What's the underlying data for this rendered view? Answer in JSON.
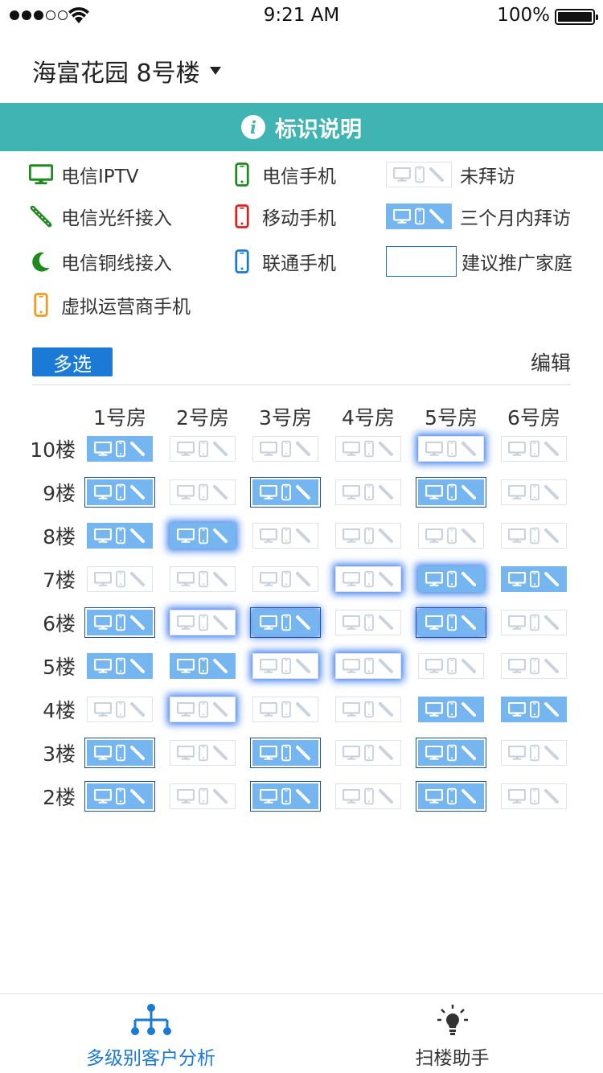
{
  "status_bar": {
    "time": "9:21 AM",
    "battery": "100%"
  },
  "header": {
    "building": "海富花园 8号楼"
  },
  "legend": {
    "title": "标识说明",
    "items": [
      {
        "icon": "tv-icon",
        "color": "#1e8a1e",
        "label": "电信IPTV"
      },
      {
        "icon": "phone-icon",
        "color": "#1e8a1e",
        "label": "电信手机"
      },
      {
        "icon": "not-visited-sample",
        "label": "未拜访"
      },
      {
        "icon": "fiber-icon",
        "color": "#1e8a1e",
        "label": "电信光纤接入"
      },
      {
        "icon": "phone-icon",
        "color": "#e02020",
        "label": "移动手机"
      },
      {
        "icon": "visited-sample",
        "label": "三个月内拜访"
      },
      {
        "icon": "copper-icon",
        "color": "#1e8a1e",
        "label": "电信铜线接入"
      },
      {
        "icon": "phone-icon",
        "color": "#1a7ad6",
        "label": "联通手机"
      },
      {
        "icon": "suggest-sample",
        "label": "建议推广家庭"
      },
      {
        "icon": "phone-icon",
        "color": "#f29a1f",
        "label": "虚拟运营商手机"
      }
    ]
  },
  "toolbar": {
    "multi_select": "多选",
    "edit": "编辑"
  },
  "colors": {
    "accent": "#1a7ad6",
    "banner": "#40b4b2",
    "visited": "#76b6f0",
    "glow": "#3f7fec"
  },
  "grid": {
    "rooms": [
      "1号房",
      "2号房",
      "3号房",
      "4号房",
      "5号房",
      "6号房"
    ],
    "floors": [
      {
        "label": "10楼",
        "cells": [
          "V",
          "U",
          "U",
          "U",
          "UG",
          "U"
        ]
      },
      {
        "label": "9楼",
        "cells": [
          "VS",
          "U",
          "VS",
          "U",
          "VS",
          "U"
        ]
      },
      {
        "label": "8楼",
        "cells": [
          "V",
          "VG",
          "U",
          "U",
          "U",
          "U"
        ]
      },
      {
        "label": "7楼",
        "cells": [
          "U",
          "U",
          "U",
          "UG",
          "VG",
          "V"
        ]
      },
      {
        "label": "6楼",
        "cells": [
          "VS",
          "UG",
          "VSG",
          "U",
          "VSG",
          "U"
        ]
      },
      {
        "label": "5楼",
        "cells": [
          "V",
          "V",
          "UG",
          "UG",
          "U",
          "U"
        ]
      },
      {
        "label": "4楼",
        "cells": [
          "U",
          "UG",
          "U",
          "U",
          "V",
          "V"
        ]
      },
      {
        "label": "3楼",
        "cells": [
          "VS",
          "U",
          "VS",
          "U",
          "VS",
          "U"
        ]
      },
      {
        "label": "2楼",
        "cells": [
          "VS",
          "U",
          "VS",
          "U",
          "VS",
          "U"
        ]
      }
    ]
  },
  "tabs": [
    {
      "label": "多级别客户分析",
      "icon": "hierarchy-icon",
      "active": true
    },
    {
      "label": "扫楼助手",
      "icon": "lightbulb-icon",
      "active": false
    }
  ]
}
